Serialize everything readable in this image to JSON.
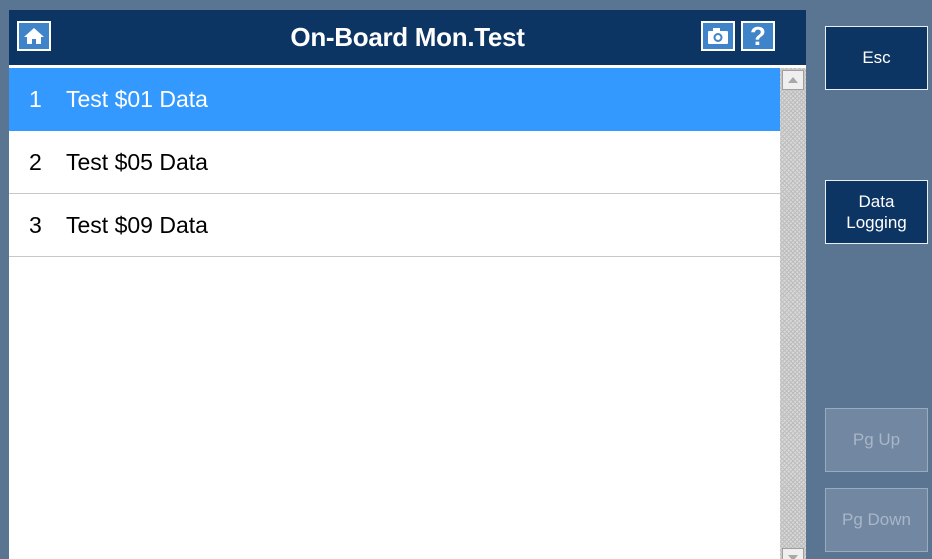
{
  "header": {
    "title": "On-Board Mon.Test",
    "help_label": "?"
  },
  "icons": {
    "home": "home-icon",
    "camera": "camera-icon",
    "help": "help-icon"
  },
  "list": {
    "items": [
      {
        "num": "1",
        "label": "Test $01 Data",
        "selected": true
      },
      {
        "num": "2",
        "label": "Test $05 Data",
        "selected": false
      },
      {
        "num": "3",
        "label": "Test $09 Data",
        "selected": false
      }
    ]
  },
  "side": {
    "esc": "Esc",
    "data_logging": "Data Logging",
    "pg_up": "Pg Up",
    "pg_down": "Pg Down"
  },
  "colors": {
    "title_bar": "#0d3564",
    "selection": "#3399ff",
    "background": "#5a7591",
    "button_active": "#0d3564",
    "button_disabled": "#7287a2"
  }
}
